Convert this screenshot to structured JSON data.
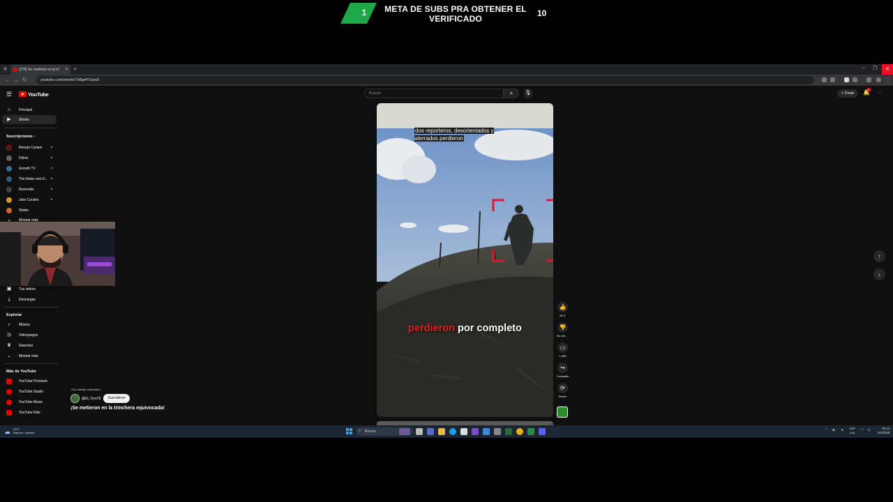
{
  "overlay": {
    "goal_current": "1",
    "goal_title": "META DE SUBS PRA OBTENER EL VERIFICADO",
    "goal_target": "10",
    "badge_color": "#1ea84a"
  },
  "browser": {
    "tab_title": "(278) Se metieron en la tri",
    "url": "youtube.com/shorts/7vBgnP1duo0"
  },
  "youtube": {
    "logo_text": "YouTube",
    "search_placeholder": "Buscar",
    "create_label": "Crear",
    "notif_count": "9+",
    "nav": [
      {
        "label": "Principal",
        "icon": "home-icon"
      },
      {
        "label": "Shorts",
        "icon": "shorts-icon"
      }
    ],
    "subs_header": "Suscripciones",
    "subscriptions": [
      {
        "label": "Renato Carlani",
        "color": "#2a2a2a"
      },
      {
        "label": "Dilera",
        "color": "#666"
      },
      {
        "label": "Growth TV",
        "color": "#3a6aa0"
      },
      {
        "label": "The Noite com D...",
        "color": "#2f5f7f"
      },
      {
        "label": "Reversão",
        "color": "#444"
      },
      {
        "label": "Julio Cocielo",
        "color": "#d89a2a"
      },
      {
        "label": "Stolen",
        "color": "#d8662a"
      }
    ],
    "show_more_subs": "Mostrar más",
    "you_items": [
      {
        "label": "Tus videos",
        "icon": "your-videos-icon"
      },
      {
        "label": "Descargas",
        "icon": "download-icon"
      }
    ],
    "explore_header": "Explorar",
    "explore_items": [
      {
        "label": "Música",
        "icon": "music-icon"
      },
      {
        "label": "Videojuegos",
        "icon": "gaming-icon"
      },
      {
        "label": "Deportes",
        "icon": "trophy-icon"
      },
      {
        "label": "Mostrar más",
        "icon": "chevron-down-icon"
      }
    ],
    "more_header": "Más de YouTube",
    "more_items": [
      {
        "label": "YouTube Premium"
      },
      {
        "label": "YouTube Studio"
      },
      {
        "label": "YouTube Music"
      },
      {
        "label": "YouTube Kids"
      }
    ]
  },
  "short": {
    "dubbing_note": "Con doblaje automático",
    "channel": "@El_Tino75",
    "subscribe_label": "Suscribirse",
    "title": "¡Se metieron en la trinchera equivocada!",
    "caption_top": "dos reporteros, desorientados y aterrados perdieron",
    "caption_main_red": "perdieron",
    "caption_main_rest": "por completo",
    "likes": "82 K",
    "dislike_label": "No me ...",
    "comments": "1,069",
    "share_label": "Compartir",
    "remix_label": "Remix"
  },
  "taskbar": {
    "temp": "23°C",
    "weather": "Mayorm. nublado",
    "search_placeholder": "Buscar",
    "lang": "ESP",
    "lang2": "LAA",
    "time": "00:12",
    "date": "6/4/2026"
  }
}
